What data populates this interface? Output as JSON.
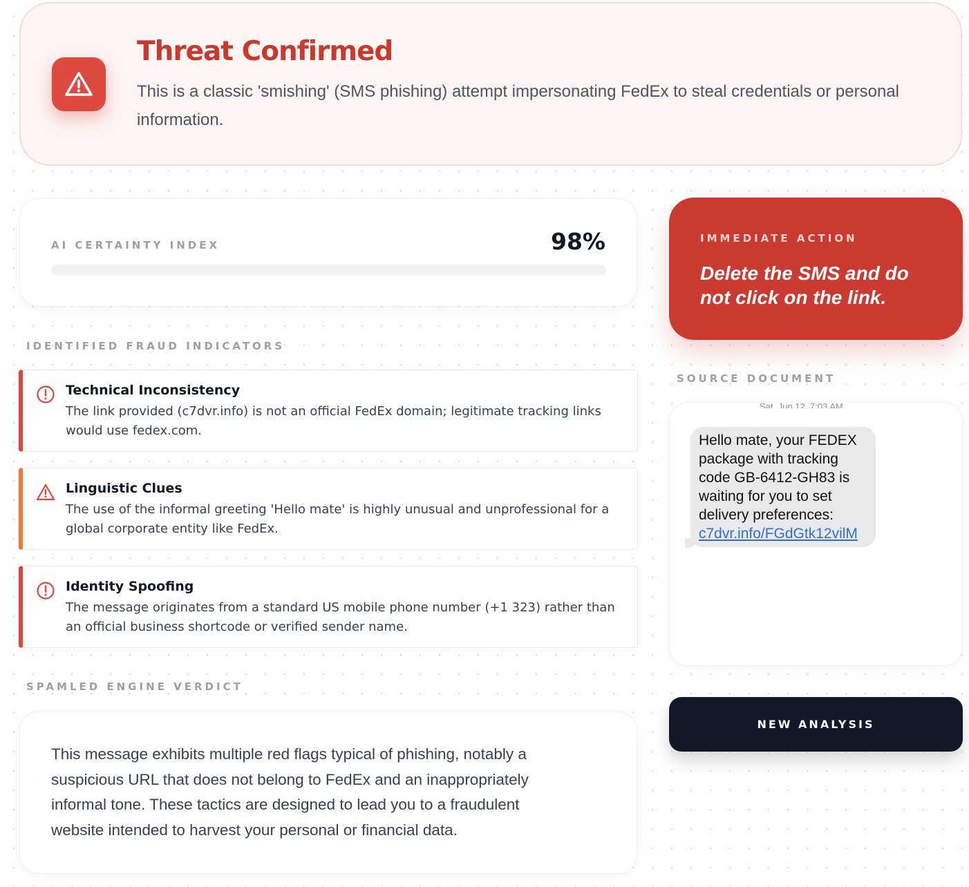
{
  "banner": {
    "icon": "warning-triangle-icon",
    "title": "Threat Confirmed",
    "subtitle": "This is a classic 'smishing' (SMS phishing) attempt impersonating FedEx to steal credentials or personal information."
  },
  "certainty": {
    "label": "AI CERTAINTY INDEX",
    "value_text": "98%",
    "value": 98
  },
  "indicators": {
    "heading": "IDENTIFIED FRAUD INDICATORS",
    "items": [
      {
        "icon": "alert-circle-icon",
        "color": "#e0463c",
        "title": "Technical Inconsistency",
        "body": "The link provided (c7dvr.info) is not an official FedEx domain; legitimate tracking links would use fedex.com."
      },
      {
        "icon": "warning-triangle-icon",
        "color": "#ef7a30",
        "title": "Linguistic Clues",
        "body": "The use of the informal greeting 'Hello mate' is highly unusual and unprofessional for a global corporate entity like FedEx."
      },
      {
        "icon": "alert-circle-icon",
        "color": "#e0463c",
        "title": "Identity Spoofing",
        "body": "The message originates from a standard US mobile phone number (+1 323) rather than an official business shortcode or verified sender name."
      }
    ]
  },
  "verdict": {
    "heading": "SPAMLED ENGINE VERDICT",
    "text": "This message exhibits multiple red flags typical of phishing, notably a suspicious URL that does not belong to FedEx and an inappropriately informal tone. These tactics are designed to lead you to a fraudulent website intended to harvest your personal or financial data."
  },
  "action": {
    "label": "IMMEDIATE ACTION",
    "text": "Delete the SMS and do not click on the link."
  },
  "source": {
    "heading": "SOURCE DOCUMENT",
    "date_partial": "Sat, Jun 12, 7:03 AM",
    "message": "Hello mate, your FEDEX package with tracking code GB-6412-GH83 is waiting for you to set delivery preferences:",
    "link": "c7dvr.info/FGdGtk12vilM"
  },
  "buttons": {
    "new_analysis": "NEW ANALYSIS"
  },
  "colors": {
    "danger": "#cb3a31",
    "warning": "#ef7a30",
    "dark": "#111827"
  }
}
